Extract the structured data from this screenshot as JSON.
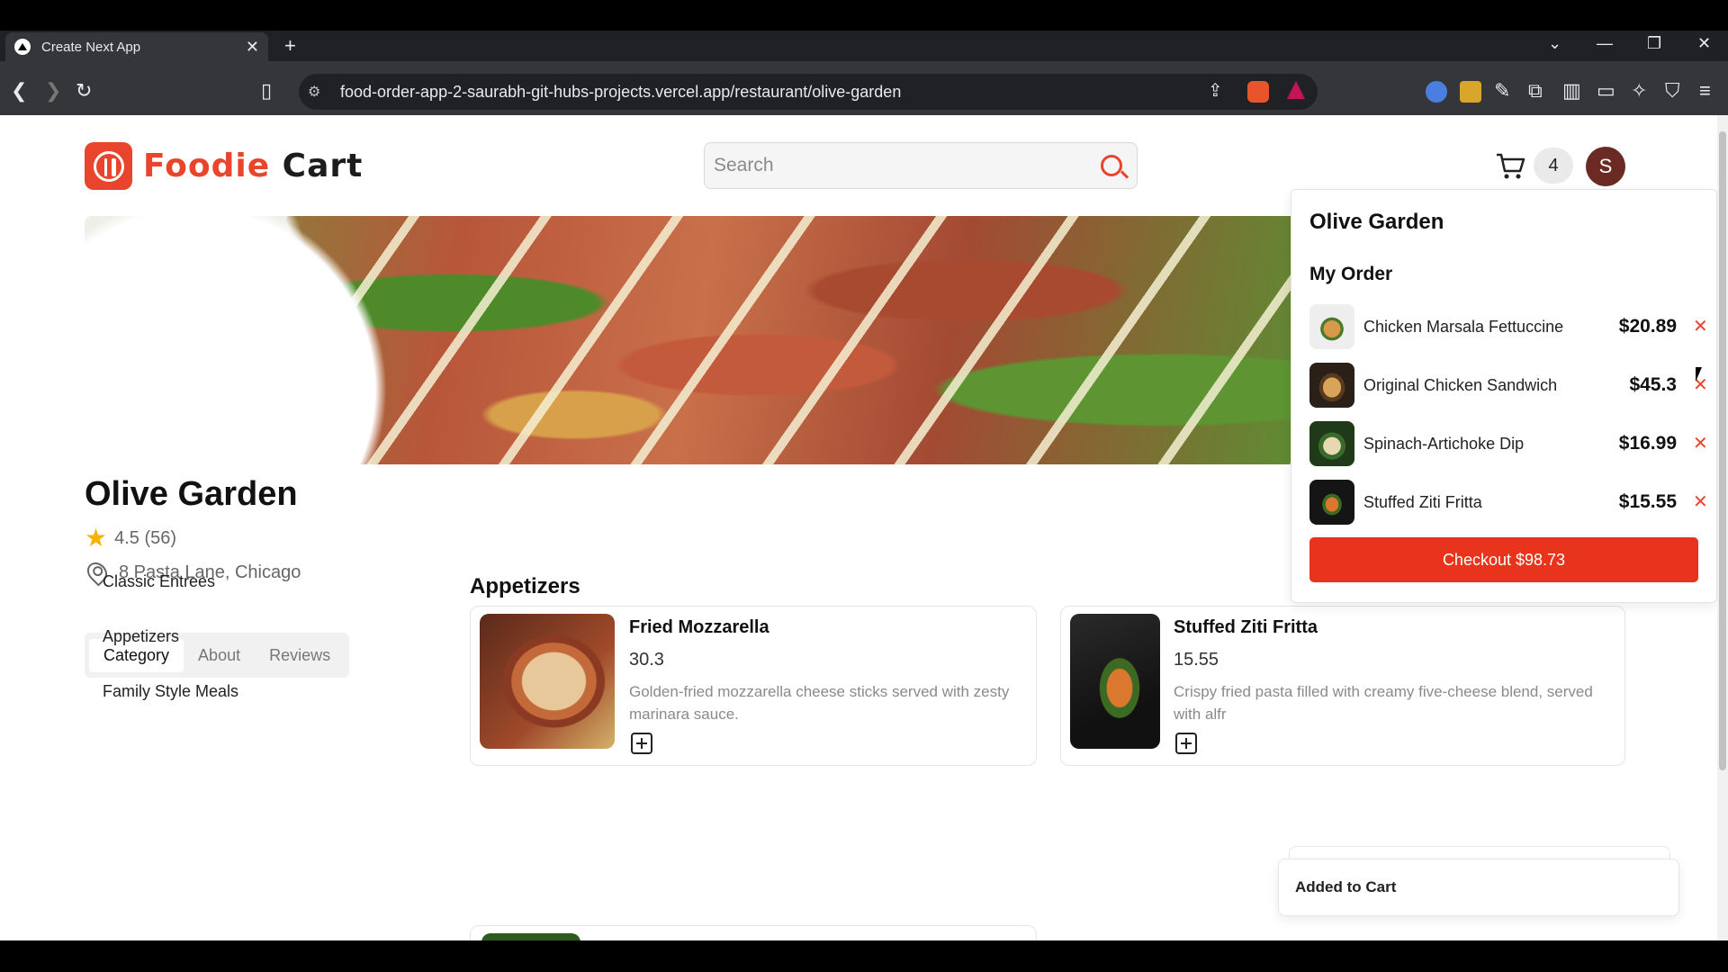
{
  "browser": {
    "tab_title": "Create Next App",
    "tab_close": "✕",
    "new_tab": "+",
    "url": "food-order-app-2-saurabh-git-hubs-projects.vercel.app/restaurant/olive-garden",
    "icons": [
      "back-icon",
      "forward-icon",
      "reload-icon",
      "bookmark-icon",
      "site-info-icon",
      "share-icon",
      "brave-shield-icon",
      "brave-rewards-icon",
      "google-translate-icon",
      "extension-icon",
      "pen-icon",
      "puzzle-icon",
      "sidebar-icon",
      "wallet-icon",
      "leo-icon",
      "vpn-icon",
      "menu-icon"
    ]
  },
  "header": {
    "logo_word1": "Foodie",
    "logo_word2": "Cart",
    "search_placeholder": "Search",
    "cart_count": "4",
    "avatar_initial": "S"
  },
  "restaurant": {
    "name": "Olive Garden",
    "rating": "4.5 (56)",
    "address": "8 Pasta Lane, Chicago"
  },
  "tabs": [
    {
      "label": "Category",
      "active": true
    },
    {
      "label": "About",
      "active": false
    },
    {
      "label": "Reviews",
      "active": false
    }
  ],
  "categories": [
    "Classic Entrees",
    "Appetizers",
    "Family Style Meals"
  ],
  "section": {
    "title": "Appetizers"
  },
  "menu_items": [
    {
      "name": "Fried Mozzarella",
      "price": "30.3",
      "description": "Golden-fried mozzarella cheese sticks served with zesty marinara sauce."
    },
    {
      "name": "Stuffed Ziti Fritta",
      "price": "15.55",
      "description": "Crispy fried pasta filled with creamy five-cheese blend, served with alfr"
    }
  ],
  "order": {
    "restaurant": "Olive Garden",
    "heading": "My Order",
    "items": [
      {
        "name": "Chicken Marsala Fettuccine",
        "price": "$20.89"
      },
      {
        "name": "Original Chicken Sandwich",
        "price": "$45.3"
      },
      {
        "name": "Spinach-Artichoke Dip",
        "price": "$16.99"
      },
      {
        "name": "Stuffed Ziti Fritta",
        "price": "$15.55"
      }
    ],
    "remove_glyph": "✕",
    "checkout_label": "Checkout $98.73"
  },
  "toast": {
    "message": "Added to Cart"
  },
  "colors": {
    "brand": "#e8452c",
    "checkout": "#e8341c",
    "avatar": "#6b2b24",
    "star": "#f5b301"
  }
}
